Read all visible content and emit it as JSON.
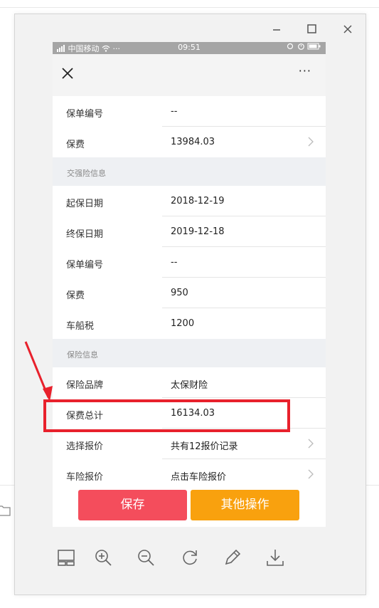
{
  "window": {
    "controls": [
      "minimize",
      "maximize",
      "close"
    ]
  },
  "status_bar": {
    "left": "中国移动",
    "time": "09:51"
  },
  "nav": {
    "more_label": "···"
  },
  "rows_top": [
    {
      "label": "保单编号",
      "value": "--",
      "chevron": false
    },
    {
      "label": "保费",
      "value": "13984.03",
      "chevron": true
    }
  ],
  "section_1": "交强险信息",
  "rows_mid": [
    {
      "label": "起保日期",
      "value": "2018-12-19"
    },
    {
      "label": "终保日期",
      "value": "2019-12-18"
    },
    {
      "label": "保单编号",
      "value": "--"
    },
    {
      "label": "保费",
      "value": "950"
    },
    {
      "label": "车船税",
      "value": "1200"
    }
  ],
  "section_2": "保险信息",
  "rows_bottom": [
    {
      "label": "保险品牌",
      "value": "太保财险",
      "chevron": false
    },
    {
      "label": "保费总计",
      "value": "16134.03",
      "chevron": false
    },
    {
      "label": "选择报价",
      "value": "共有12报价记录",
      "chevron": true
    },
    {
      "label": "车险报价",
      "value": "点击车险报价",
      "chevron": true
    }
  ],
  "buttons": {
    "save": "保存",
    "other": "其他操作"
  },
  "colors": {
    "save": "#f44d5c",
    "other": "#f9a10e",
    "highlight": "#e8212c"
  },
  "toolbar": [
    "thumbnail-icon",
    "zoom-in-icon",
    "zoom-out-icon",
    "rotate-icon",
    "edit-icon",
    "download-icon"
  ]
}
